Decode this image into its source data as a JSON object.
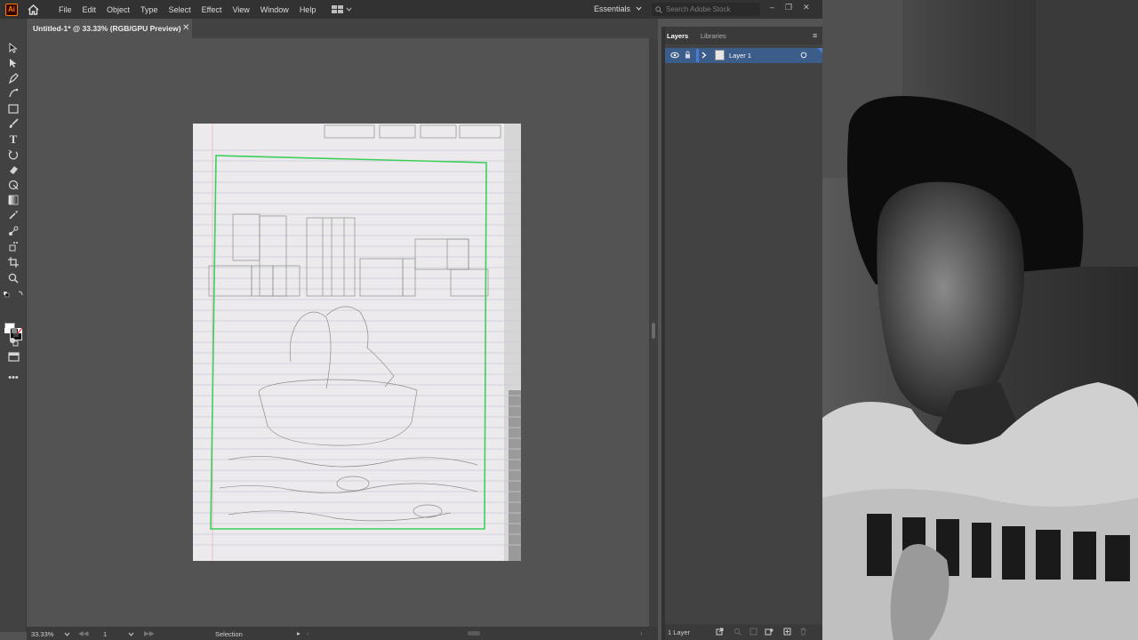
{
  "app": {
    "logo": "Ai"
  },
  "menu": [
    "File",
    "Edit",
    "Object",
    "Type",
    "Select",
    "Effect",
    "View",
    "Window",
    "Help"
  ],
  "workspace": "Essentials",
  "stock_search": {
    "placeholder": "Search Adobe Stock"
  },
  "document": {
    "tab_title": "Untitled-1* @ 33.33% (RGB/GPU Preview)"
  },
  "status": {
    "zoom": "33.33%",
    "artboard": "1",
    "tool": "Selection"
  },
  "panel": {
    "tabs": [
      "Layers",
      "Libraries"
    ],
    "layers": [
      {
        "name": "Layer 1"
      }
    ],
    "footer_count": "1 Layer"
  },
  "colors": {
    "selection_accent": "#4b7bd1",
    "artboard_frame": "#3ccf5a",
    "app_logo": "#ff7c00"
  },
  "icons": [
    "home-icon",
    "selection-tool-icon",
    "direct-selection-tool-icon",
    "pen-tool-icon",
    "curvature-tool-icon",
    "rectangle-tool-icon",
    "paintbrush-tool-icon",
    "type-tool-icon",
    "rotate-tool-icon",
    "eraser-tool-icon",
    "warp-tool-icon",
    "gradient-tool-icon",
    "eyedropper-tool-icon",
    "blend-tool-icon",
    "symbol-sprayer-icon",
    "artboard-tool-icon",
    "zoom-tool-icon",
    "eye-icon",
    "lock-icon",
    "chevron-right-icon"
  ]
}
